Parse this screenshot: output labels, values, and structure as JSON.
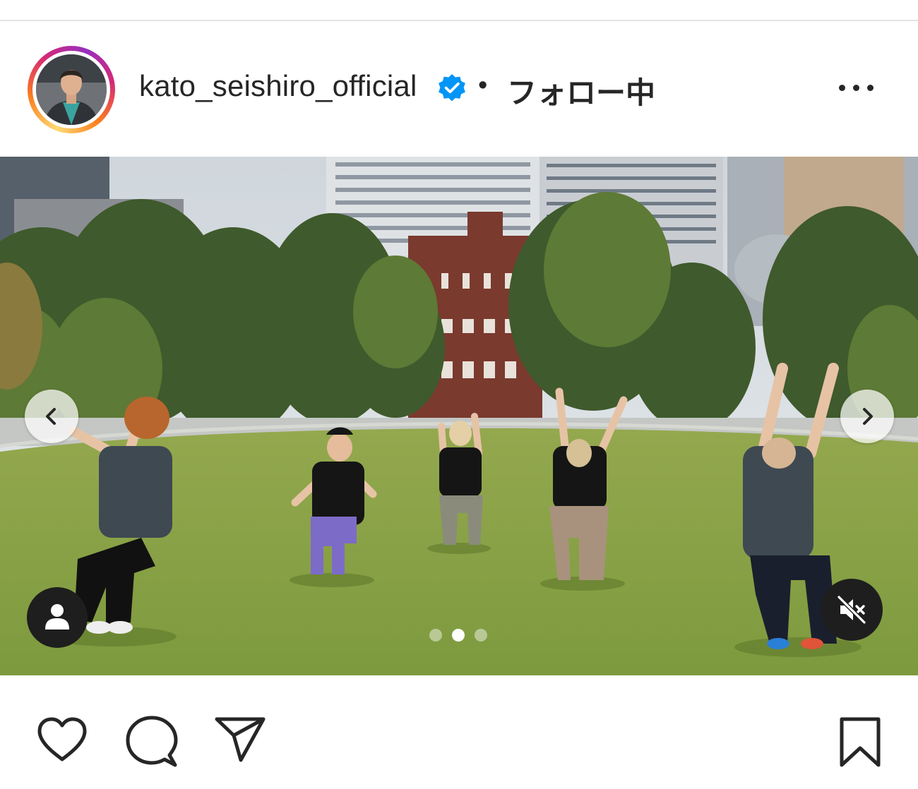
{
  "header": {
    "username": "kato_seishiro_official",
    "verified": true,
    "separator": "•",
    "follow_status": "フォロー中",
    "more_icon": "ellipsis-icon",
    "avatar_ring_colors": [
      "#feda75",
      "#fa7e1e",
      "#d62976",
      "#962fbf"
    ]
  },
  "media": {
    "carousel": {
      "count": 3,
      "active_index": 1
    },
    "prev_icon": "chevron-left-icon",
    "next_icon": "chevron-right-icon",
    "tag_icon": "person-icon",
    "audio_icon": "speaker-muted-icon",
    "audio_muted": true
  },
  "actions": {
    "like_icon": "heart-icon",
    "comment_icon": "comment-icon",
    "share_icon": "paper-plane-icon",
    "save_icon": "bookmark-icon"
  },
  "colors": {
    "text": "#262626",
    "verified_badge": "#0095f6",
    "divider": "#e3e3e3"
  }
}
